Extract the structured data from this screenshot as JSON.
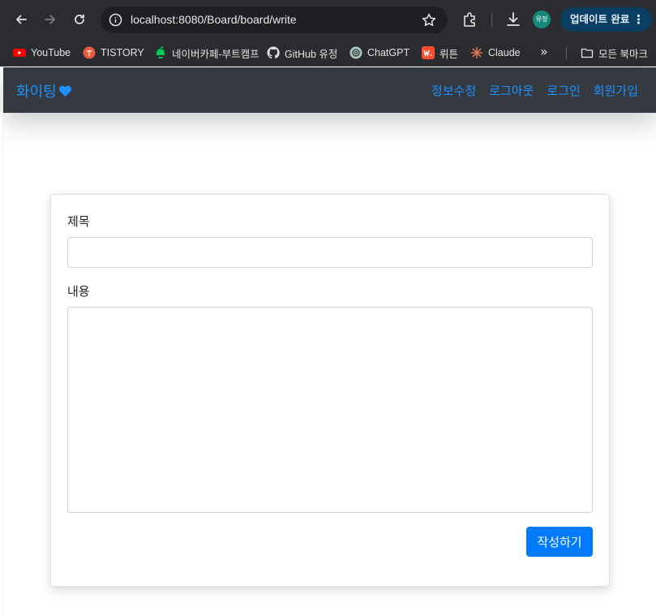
{
  "browser": {
    "url": "localhost:8080/Board/board/write",
    "profile_initials": "유정",
    "update_button_label": "업데이트 완료",
    "bookmarks": [
      {
        "label": "YouTube",
        "icon": "youtube-icon"
      },
      {
        "label": "TISTORY",
        "icon": "tistory-icon"
      },
      {
        "label": "네이버카페-부트캠프",
        "icon": "naver-cafe-icon"
      },
      {
        "label": "GitHub 유정",
        "icon": "github-icon"
      },
      {
        "label": "ChatGPT",
        "icon": "chatgpt-icon"
      },
      {
        "label": "뤼튼",
        "icon": "wrtn-icon"
      },
      {
        "label": "Claude",
        "icon": "claude-icon"
      }
    ],
    "bookmarks_folder_label": "모든 북마크",
    "more_bookmarks_glyph": "»"
  },
  "navbar": {
    "brand": "화이팅",
    "links": [
      "정보수정",
      "로그아웃",
      "로그인",
      "회원가입"
    ],
    "accent_color": "#1e90ff",
    "background_color": "#343a40"
  },
  "form": {
    "title_label": "제목",
    "title_value": "",
    "content_label": "내용",
    "content_value": "",
    "submit_label": "작성하기",
    "submit_color": "#007bff"
  }
}
